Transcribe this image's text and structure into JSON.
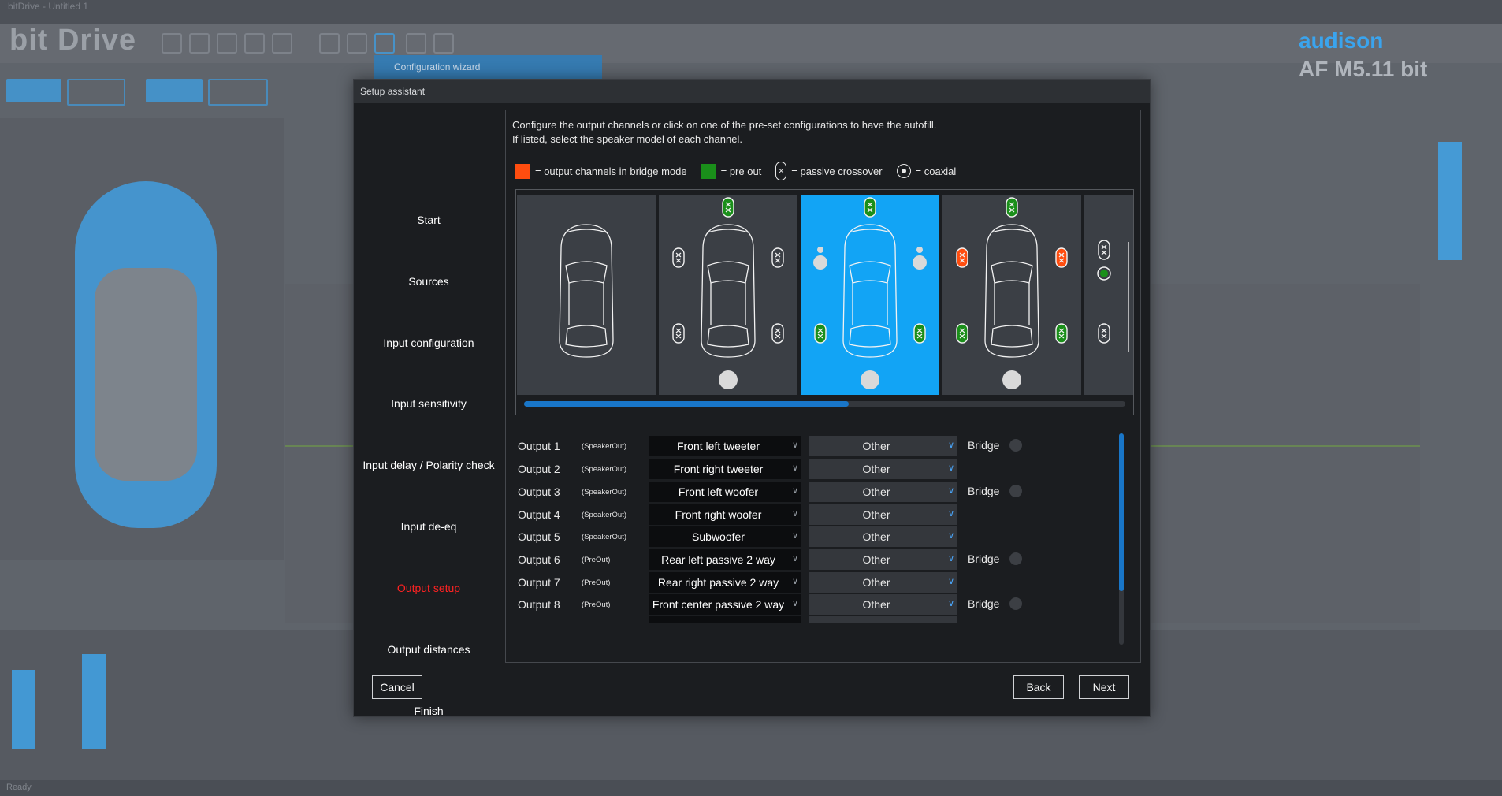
{
  "background": {
    "app_name": "bitDrive - Untitled 1",
    "logo": "bit Drive",
    "brand": "audison",
    "model": "AF M5.11 bit",
    "popup": "Configuration wizard",
    "status": "Ready"
  },
  "dialog": {
    "title": "Setup assistant",
    "nav": [
      {
        "label": "Start"
      },
      {
        "label": "Sources"
      },
      {
        "label": "Input configuration"
      },
      {
        "label": "Input sensitivity"
      },
      {
        "label": "Input delay / Polarity check"
      },
      {
        "label": "Input de-eq"
      },
      {
        "label": "Output setup",
        "active": true
      },
      {
        "label": "Output distances"
      },
      {
        "label": "Finish"
      }
    ],
    "intro_line1": "Configure the output channels or click on one of the pre-set configurations to have the autofill.",
    "intro_line2": "If listed, select the speaker model of each channel.",
    "legend": {
      "bridge": "= output channels in bridge mode",
      "preout": "= pre out",
      "passive": "= passive crossover",
      "coaxial": "= coaxial"
    },
    "presets": {
      "selected_index": 2,
      "scroll_fraction": 0.54,
      "colors": {
        "selected": "#12a4f5",
        "card": "#3b3f45",
        "bridge": "#ff4d0f",
        "preout": "#1a8f1a"
      }
    },
    "outputs": [
      {
        "name": "Output 1",
        "type": "(SpeakerOut)",
        "speaker": "Front left tweeter",
        "model": "Other",
        "bridge": "Bridge"
      },
      {
        "name": "Output 2",
        "type": "(SpeakerOut)",
        "speaker": "Front right tweeter",
        "model": "Other",
        "bridge": ""
      },
      {
        "name": "Output 3",
        "type": "(SpeakerOut)",
        "speaker": "Front left woofer",
        "model": "Other",
        "bridge": "Bridge"
      },
      {
        "name": "Output 4",
        "type": "(SpeakerOut)",
        "speaker": "Front right woofer",
        "model": "Other",
        "bridge": ""
      },
      {
        "name": "Output 5",
        "type": "(SpeakerOut)",
        "speaker": "Subwoofer",
        "model": "Other",
        "bridge": ""
      },
      {
        "name": "Output 6",
        "type": "(PreOut)",
        "speaker": "Rear left passive 2 way",
        "model": "Other",
        "bridge": "Bridge"
      },
      {
        "name": "Output 7",
        "type": "(PreOut)",
        "speaker": "Rear right passive 2 way",
        "model": "Other",
        "bridge": ""
      },
      {
        "name": "Output 8",
        "type": "(PreOut)",
        "speaker": "Front center passive 2 way",
        "model": "Other",
        "bridge": "Bridge"
      }
    ],
    "buttons": {
      "cancel": "Cancel",
      "back": "Back",
      "next": "Next"
    }
  }
}
